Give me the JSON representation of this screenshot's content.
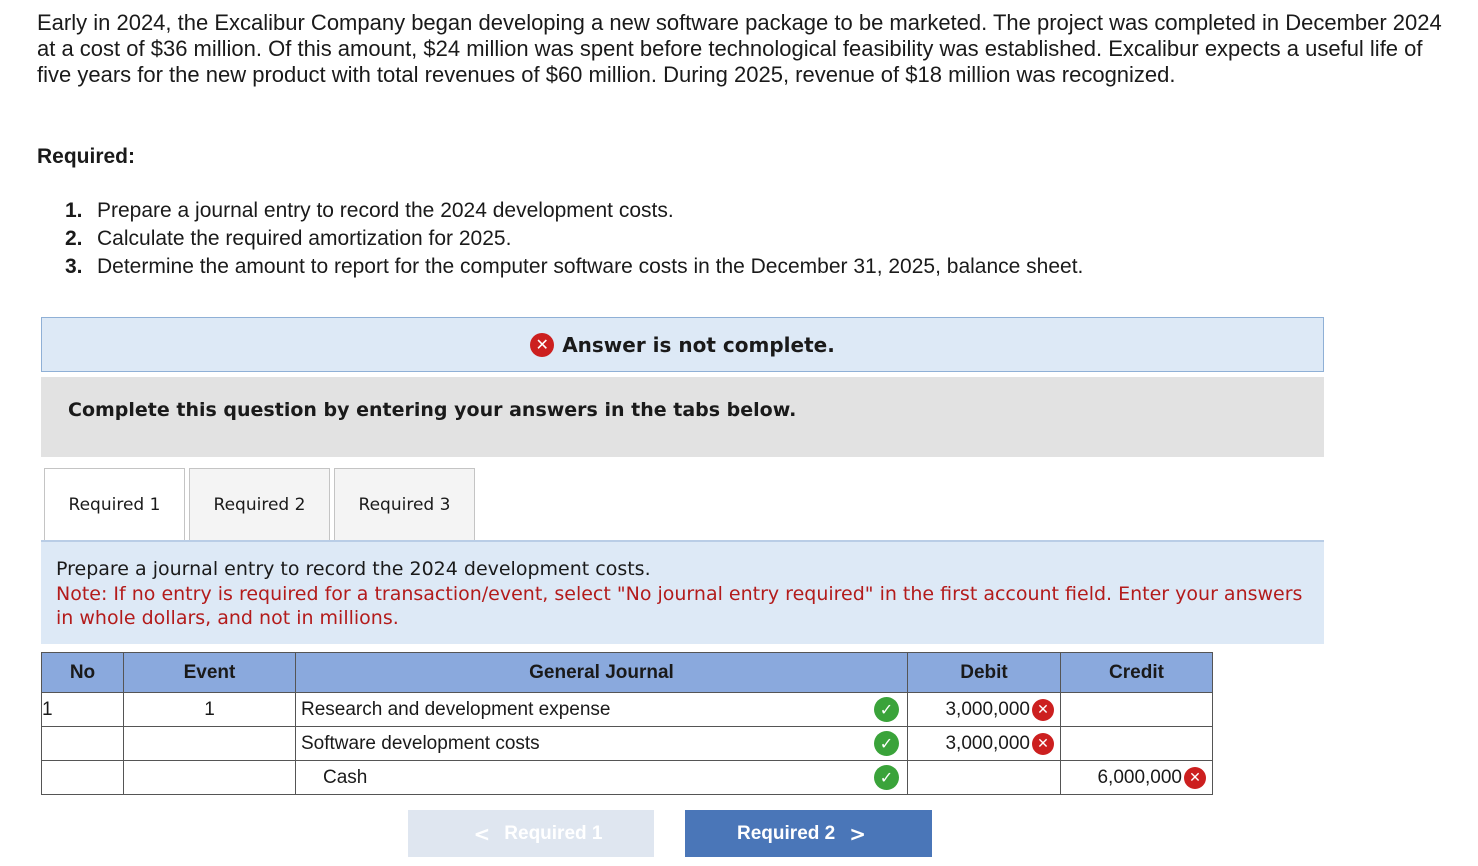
{
  "problem": {
    "text": "Early in 2024, the Excalibur Company began developing a new software package to be marketed. The project was completed in December 2024 at a cost of $36 million. Of this amount, $24 million was spent before technological feasibility was established. Excalibur expects a useful life of five years for the new product with total revenues of $60 million. During 2025, revenue of $18 million was recognized."
  },
  "required": {
    "heading": "Required:",
    "items": [
      {
        "num": "1.",
        "text": "Prepare a journal entry to record the 2024 development costs."
      },
      {
        "num": "2.",
        "text": "Calculate the required amortization for 2025."
      },
      {
        "num": "3.",
        "text": "Determine the amount to report for the computer software costs in the December 31, 2025, balance sheet."
      }
    ]
  },
  "status": {
    "icon": "x-circle-icon",
    "text": "Answer is not complete.",
    "color": "#cc1f1f"
  },
  "instruction": "Complete this question by entering your answers in the tabs below.",
  "tabs": [
    {
      "label": "Required 1",
      "active": true
    },
    {
      "label": "Required 2",
      "active": false
    },
    {
      "label": "Required 3",
      "active": false
    }
  ],
  "prompt": {
    "text": "Prepare a journal entry to record the 2024 development costs.",
    "note": "Note: If no entry is required for a transaction/event, select \"No journal entry required\" in the first account field. Enter your answers in whole dollars, and not in millions."
  },
  "journal": {
    "headers": {
      "no": "No",
      "event": "Event",
      "general_journal": "General Journal",
      "debit": "Debit",
      "credit": "Credit"
    },
    "rows": [
      {
        "no": "1",
        "event": "1",
        "account": "Research and development expense",
        "account_status": "correct",
        "debit": "3,000,000",
        "debit_status": "incorrect",
        "credit": "",
        "credit_status": ""
      },
      {
        "no": "",
        "event": "",
        "account": "Software development costs",
        "account_status": "correct",
        "debit": "3,000,000",
        "debit_status": "incorrect",
        "credit": "",
        "credit_status": ""
      },
      {
        "no": "",
        "event": "",
        "account": "Cash",
        "account_status": "correct",
        "debit": "",
        "debit_status": "",
        "credit": "6,000,000",
        "credit_status": "incorrect"
      }
    ]
  },
  "navigation": {
    "prev_label": "Required 1",
    "next_label": "Required 2",
    "prev_icon": "chevron-left-icon",
    "next_icon": "chevron-right-icon"
  },
  "colors": {
    "correct": "#3aa33a",
    "incorrect": "#cc1f1f",
    "header_blue": "#8aa9dd",
    "button_blue": "#4a76b8"
  }
}
